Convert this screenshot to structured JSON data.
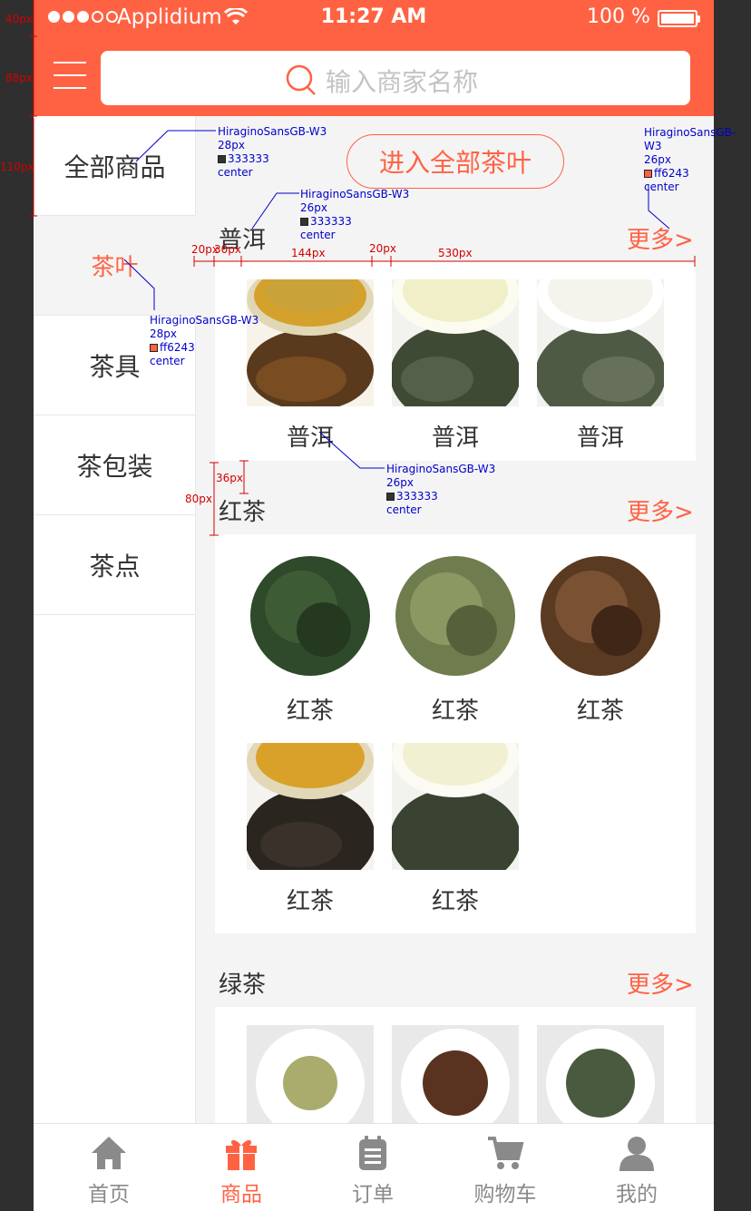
{
  "status_bar": {
    "carrier": "Applidium",
    "time": "11:27 AM",
    "battery": "100 %"
  },
  "search": {
    "placeholder": "输入商家名称"
  },
  "sidebar": {
    "items": [
      {
        "label": "全部商品"
      },
      {
        "label": "茶叶",
        "active": true
      },
      {
        "label": "茶具"
      },
      {
        "label": "茶包装"
      },
      {
        "label": "茶点"
      }
    ]
  },
  "enter_all_button": "进入全部茶叶",
  "sections": [
    {
      "title": "普洱",
      "more": "更多>",
      "products": [
        "普洱",
        "普洱",
        "普洱"
      ]
    },
    {
      "title": "红茶",
      "more": "更多>",
      "products": [
        "红茶",
        "红茶",
        "红茶",
        "红茶",
        "红茶"
      ]
    },
    {
      "title": "绿茶",
      "more": "更多>",
      "products": [
        "",
        "",
        ""
      ]
    }
  ],
  "tabbar": {
    "items": [
      {
        "label": "首页",
        "icon": "home-icon"
      },
      {
        "label": "商品",
        "icon": "gift-icon",
        "active": true
      },
      {
        "label": "订单",
        "icon": "clipboard-icon"
      },
      {
        "label": "购物车",
        "icon": "cart-icon"
      },
      {
        "label": "我的",
        "icon": "user-icon"
      }
    ]
  },
  "colors": {
    "accent": "#ff6243",
    "text": "#333333",
    "background": "#f4f4f4"
  },
  "annotations": {
    "a1": {
      "font": "HiraginoSansGB-W3",
      "size": "28px",
      "color": "333333",
      "align": "center"
    },
    "a2": {
      "font": "HiraginoSansGB-W3",
      "size": "26px",
      "color": "333333",
      "align": "center"
    },
    "a3": {
      "font": "HiraginoSansGB-W3",
      "size": "26px",
      "color": "ff6243",
      "align": "center"
    },
    "a4": {
      "font": "HiraginoSansGB-W3",
      "size": "28px",
      "color": "ff6243",
      "align": "center"
    },
    "a5": {
      "font": "HiraginoSansGB-W3",
      "size": "26px",
      "color": "333333",
      "align": "center"
    }
  },
  "dimensions": {
    "d40": "40px",
    "d88": "88px",
    "d110": "110px",
    "d20a": "20px",
    "d30": "30px",
    "d144": "144px",
    "d20b": "20px",
    "d530": "530px",
    "d36": "36px",
    "d80": "80px"
  }
}
